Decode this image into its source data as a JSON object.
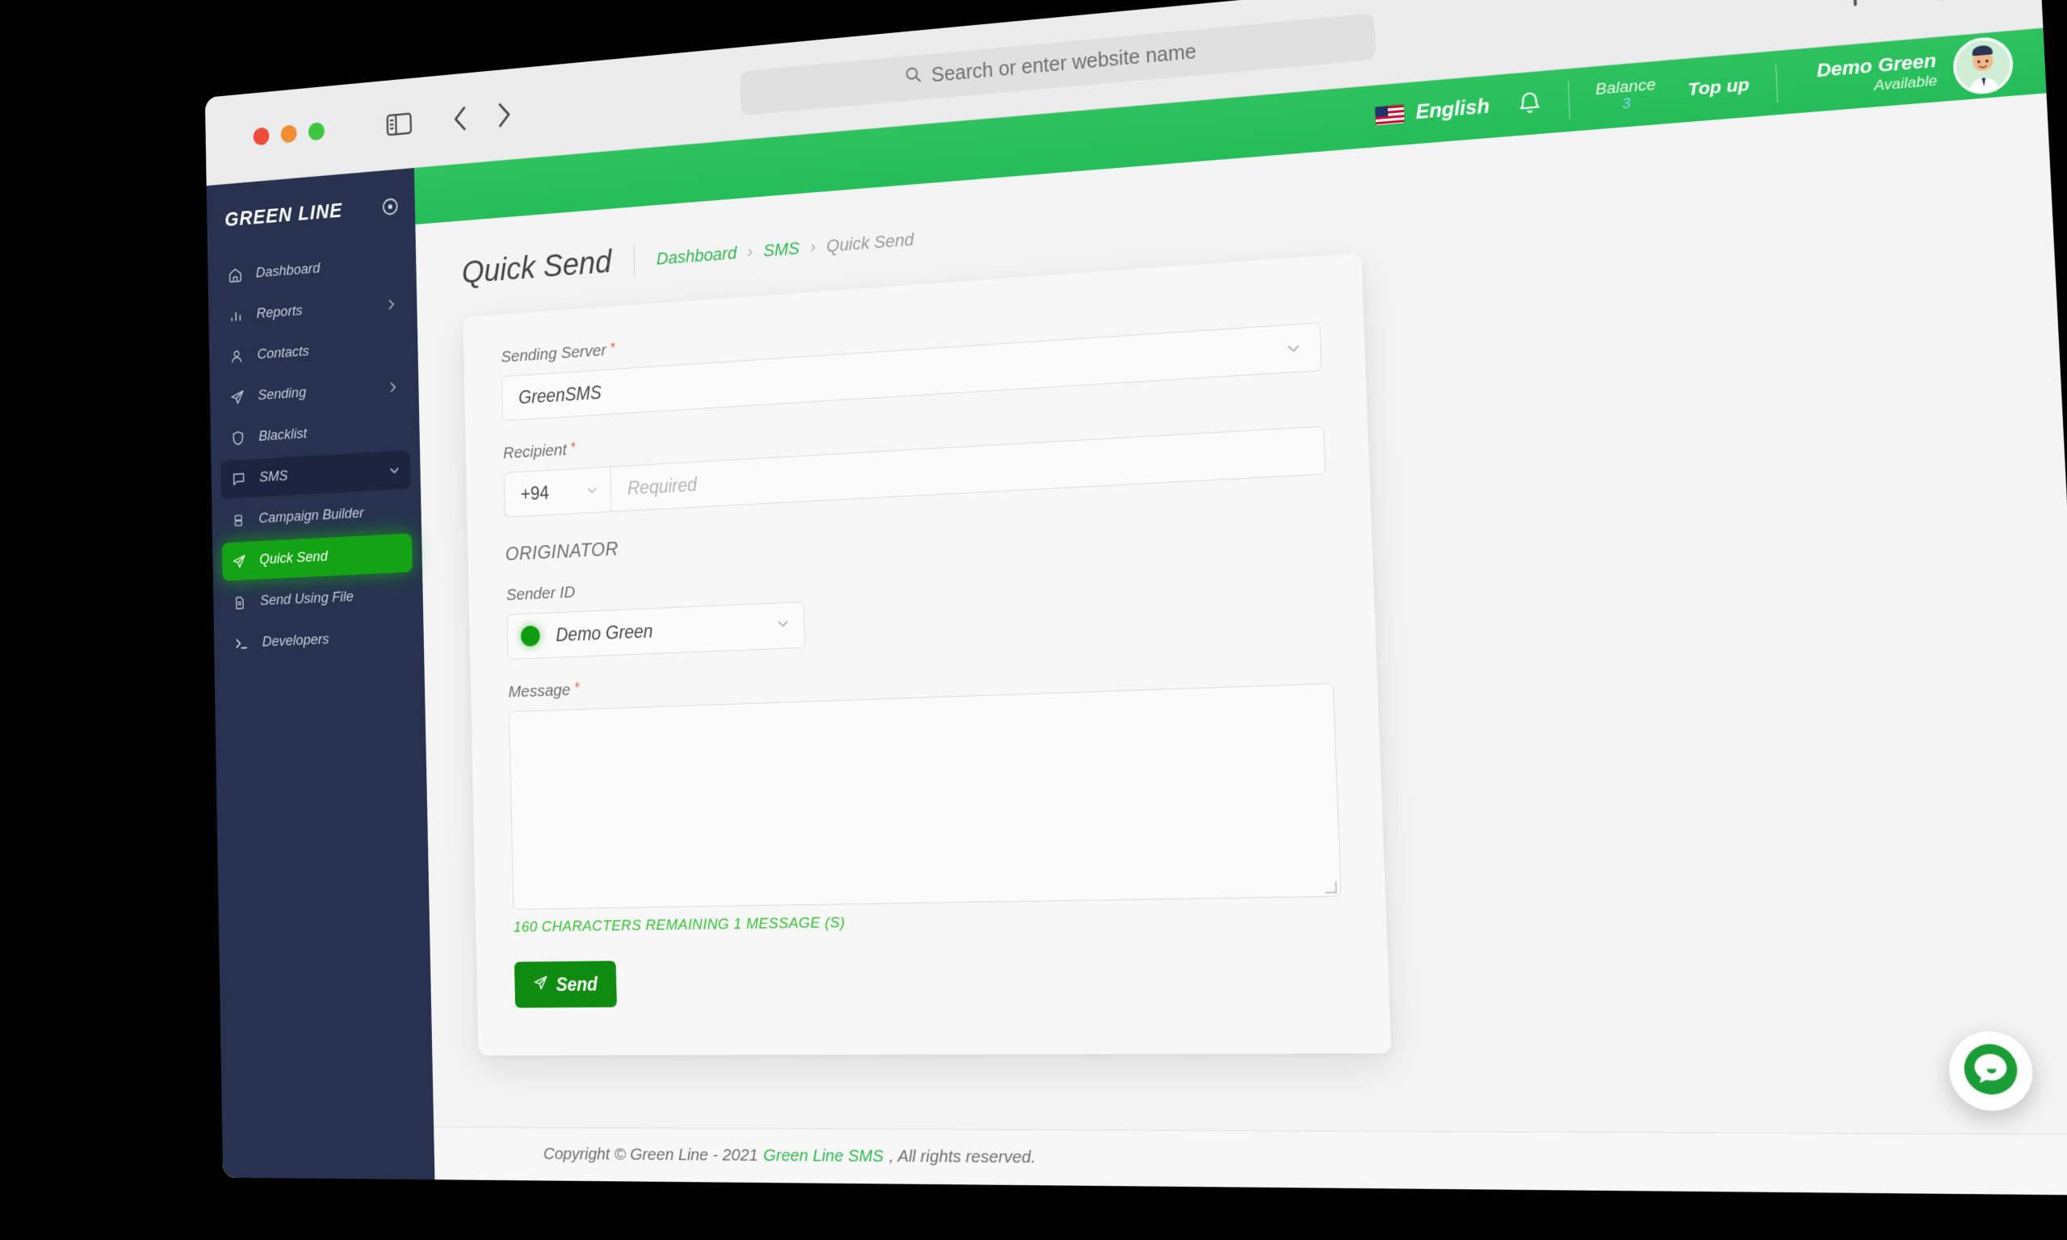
{
  "browser": {
    "url_placeholder": "Search or enter website name",
    "search_icon": "search-icon",
    "sidebar_toggle_icon": "sidebar-toggle-icon",
    "back_icon": "chevron-left-icon",
    "forward_icon": "chevron-right-icon",
    "new_tab_icon": "plus-icon",
    "tab_overview_icon": "tab-overview-icon"
  },
  "sidebar": {
    "brand": "GREEN LINE",
    "brand_mark_icon": "target-circle-icon",
    "items": [
      {
        "label": "Dashboard",
        "icon": "home-icon",
        "state": "normal",
        "chevron": ""
      },
      {
        "label": "Reports",
        "icon": "bar-chart-icon",
        "state": "normal",
        "chevron": "chevron-right-icon"
      },
      {
        "label": "Contacts",
        "icon": "user-icon",
        "state": "normal",
        "chevron": ""
      },
      {
        "label": "Sending",
        "icon": "paper-plane-icon",
        "state": "normal",
        "chevron": "chevron-right-icon"
      },
      {
        "label": "Blacklist",
        "icon": "shield-icon",
        "state": "normal",
        "chevron": ""
      },
      {
        "label": "SMS",
        "icon": "message-square-icon",
        "state": "expanded",
        "chevron": "chevron-down-icon"
      },
      {
        "label": "Campaign Builder",
        "icon": "layers-icon",
        "state": "sub",
        "chevron": ""
      },
      {
        "label": "Quick Send",
        "icon": "paper-plane-icon",
        "state": "active",
        "chevron": ""
      },
      {
        "label": "Send Using File",
        "icon": "file-icon",
        "state": "sub",
        "chevron": ""
      },
      {
        "label": "Developers",
        "icon": "terminal-icon",
        "state": "normal",
        "chevron": ""
      }
    ]
  },
  "topbar": {
    "flag_icon": "us-flag-icon",
    "language": "English",
    "bell_icon": "bell-icon",
    "balance_label": "Balance",
    "balance_value": "3",
    "topup_label": "Top up",
    "account_name": "Demo Green",
    "account_status": "Available",
    "avatar_icon": "user-avatar"
  },
  "page": {
    "title": "Quick Send",
    "breadcrumb": [
      {
        "label": "Dashboard",
        "type": "link"
      },
      {
        "label": "SMS",
        "type": "link"
      },
      {
        "label": "Quick Send",
        "type": "current"
      }
    ],
    "breadcrumb_separator": "›"
  },
  "form": {
    "sending_server": {
      "label": "Sending Server",
      "required_marker": "*",
      "value": "GreenSMS",
      "chevron_icon": "chevron-down-icon"
    },
    "recipient": {
      "label": "Recipient",
      "required_marker": "*",
      "country_code": "+94",
      "country_chevron_icon": "chevron-down-icon",
      "placeholder": "Required"
    },
    "originator_section": "ORIGINATOR",
    "sender_id": {
      "label": "Sender ID",
      "value": "Demo Green",
      "status_dot_color": "#109c10",
      "chevron_icon": "chevron-down-icon"
    },
    "message": {
      "label": "Message",
      "required_marker": "*",
      "value": "",
      "counter": "160 CHARACTERS REMAINING 1 MESSAGE (S)"
    },
    "send_button": {
      "label": "Send",
      "icon": "paper-plane-icon"
    }
  },
  "footer": {
    "copyright": "Copyright © Green Line - 2021",
    "link": "Green Line SMS",
    "rights": ", All rights reserved."
  },
  "chat": {
    "icon": "chat-bubble-icon"
  },
  "colors": {
    "brand_green": "#2bc260",
    "dark_navy": "#27324f",
    "active_green": "#14a314",
    "send_green": "#0f8c0f",
    "required_red": "#e8684a"
  }
}
